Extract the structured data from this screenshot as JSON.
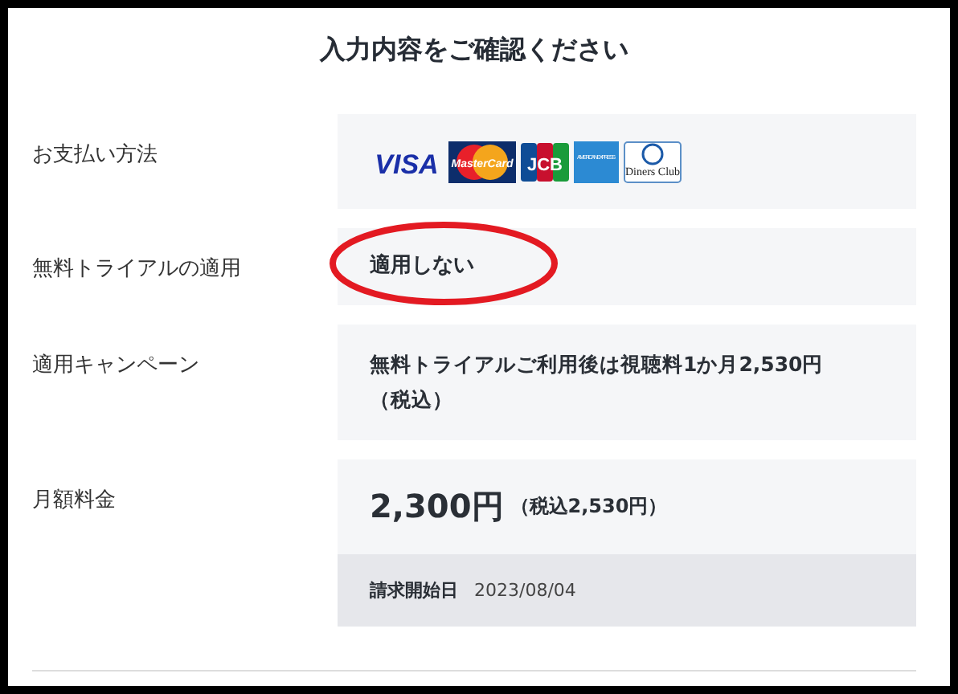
{
  "title": "入力内容をご確認ください",
  "rows": [
    {
      "kind": "cards",
      "label": "お支払い方法",
      "cards": [
        {
          "kind": "visa",
          "text": "VISA"
        },
        {
          "kind": "master",
          "text": "MasterCard"
        },
        {
          "kind": "jcb",
          "text": "JCB"
        },
        {
          "kind": "amex",
          "text": "AMERICAN EXPRESS"
        },
        {
          "kind": "diners",
          "text": "Diners Club"
        }
      ]
    },
    {
      "kind": "text",
      "label": "無料トライアルの適用",
      "value": "適用しない",
      "circled": true
    },
    {
      "kind": "text",
      "label": "適用キャンペーン",
      "value": "無料トライアルご利用後は視聴料1か月2,530円（税込）",
      "circled": false
    },
    {
      "kind": "price",
      "label": "月額料金",
      "price": "2,300円",
      "tax": "（税込2,530円）",
      "start_label": "請求開始日",
      "start_date": "2023/08/04"
    }
  ]
}
